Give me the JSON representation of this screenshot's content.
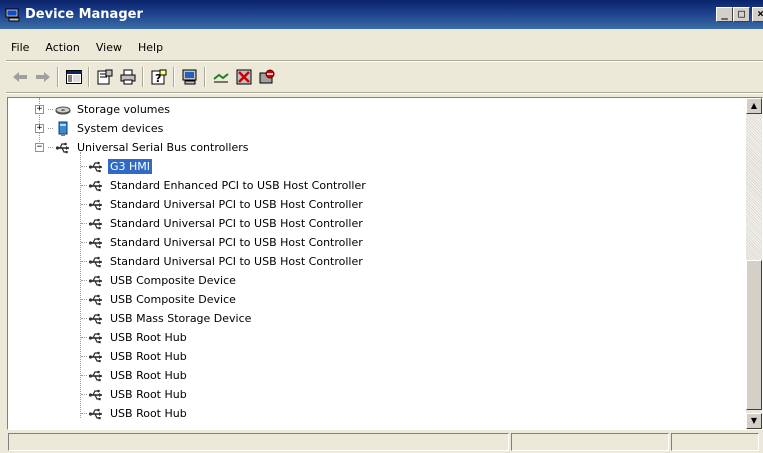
{
  "window": {
    "title": "Device Manager",
    "minimize_label": "_",
    "maximize_label": "□",
    "close_label": "×"
  },
  "menu": {
    "items": [
      "File",
      "Action",
      "View",
      "Help"
    ]
  },
  "toolbar": {
    "buttons": [
      "back-icon",
      "forward-icon",
      "console-tree-icon",
      "properties-icon",
      "print-icon",
      "help-icon",
      "scan-hardware-icon",
      "update-driver-icon",
      "uninstall-icon",
      "disable-icon"
    ]
  },
  "tree": {
    "categories": [
      {
        "label": "Storage volumes",
        "expander": "+"
      },
      {
        "label": "System devices",
        "expander": "+"
      },
      {
        "label": "Universal Serial Bus controllers",
        "expander": "−"
      }
    ],
    "usb_devices": [
      "G3 HMI",
      "Standard Enhanced PCI to USB Host Controller",
      "Standard Universal PCI to USB Host Controller",
      "Standard Universal PCI to USB Host Controller",
      "Standard Universal PCI to USB Host Controller",
      "Standard Universal PCI to USB Host Controller",
      "USB Composite Device",
      "USB Composite Device",
      "USB Mass Storage Device",
      "USB Root Hub",
      "USB Root Hub",
      "USB Root Hub",
      "USB Root Hub",
      "USB Root Hub"
    ],
    "selected_device": "G3 HMI"
  },
  "scrollbar": {
    "up_arrow": "▲",
    "down_arrow": "▼"
  },
  "statusbar": {
    "panes": [
      "",
      "",
      ""
    ]
  }
}
